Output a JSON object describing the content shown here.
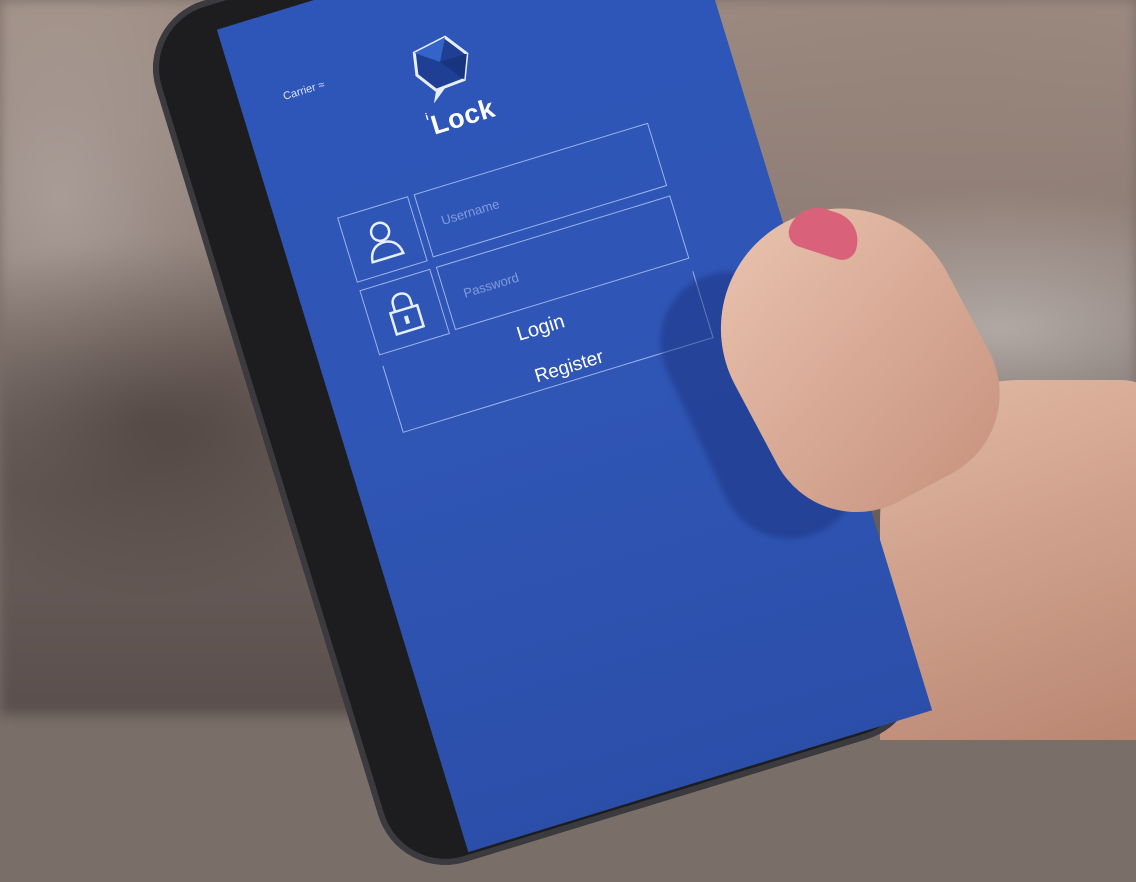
{
  "status_bar": {
    "carrier": "Carrier"
  },
  "app": {
    "logo_icon": "speech-bubble-gem-icon",
    "name": "Lock",
    "name_prefix": "i"
  },
  "login_form": {
    "username": {
      "icon": "user-icon",
      "placeholder": "Username"
    },
    "password": {
      "icon": "padlock-icon",
      "placeholder": "Password"
    },
    "login_label": "Login",
    "register_label": "Register"
  },
  "colors": {
    "screen_bg": "#2f55b5",
    "field_border": "#cddaff",
    "text": "#ffffff"
  }
}
